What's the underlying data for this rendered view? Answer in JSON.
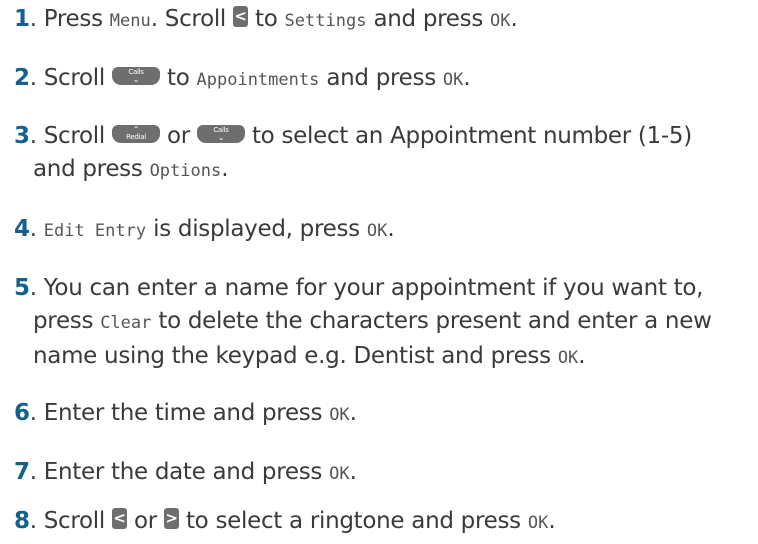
{
  "steps": [
    {
      "num": "1",
      "t1": ". Press ",
      "lcd1": "Menu",
      "t2": ". Scroll ",
      "key1": "<",
      "t3": " to ",
      "lcd2": "Settings",
      "t4": " and press ",
      "lcd3": "OK",
      "t5": "."
    },
    {
      "num": "2",
      "t1": ". Scroll ",
      "key1": "Calls",
      "key1_glyph": "⌄",
      "t2": " to ",
      "lcd1": "Appointments",
      "t3": " and press ",
      "lcd2": "OK",
      "t4": "."
    },
    {
      "num": "3",
      "t1": ". Scroll ",
      "key1": "Redial",
      "key1_glyph": "⌃",
      "t2": " or ",
      "key2": "Calls",
      "key2_glyph": "⌄",
      "t3": " to select an Appointment number (1-5)",
      "t4": "and press ",
      "lcd1": "Options",
      "t5": "."
    },
    {
      "num": "4",
      "t1": ". ",
      "lcd1": "Edit Entry",
      "t2": " is displayed, press ",
      "lcd2": "OK",
      "t3": "."
    },
    {
      "num": "5",
      "t1": ". You can enter a name for your appointment if you want to,",
      "t2": "press ",
      "lcd1": "Clear",
      "t3": " to delete the characters present and enter a new",
      "t4": "name using the keypad e.g. Dentist and press ",
      "lcd2": "OK",
      "t5": "."
    },
    {
      "num": "6",
      "t1": ". Enter the time and press ",
      "lcd1": "OK",
      "t2": "."
    },
    {
      "num": "7",
      "t1": ". Enter the date and press ",
      "lcd1": "OK",
      "t2": "."
    },
    {
      "num": "8",
      "t1": ". Scroll ",
      "key1": "<",
      "t2": " or ",
      "key2": ">",
      "t3": " to select a ringtone and press ",
      "lcd1": "OK",
      "t4": "."
    }
  ],
  "colors": {
    "step_number": "#14608f",
    "body_text": "#3a3a3a",
    "key_background": "#6e6e6e"
  },
  "icons": {
    "left_key": "left-arrow-key-icon",
    "right_key": "right-arrow-key-icon",
    "calls_key": "calls-down-key-icon",
    "redial_key": "redial-up-key-icon"
  }
}
